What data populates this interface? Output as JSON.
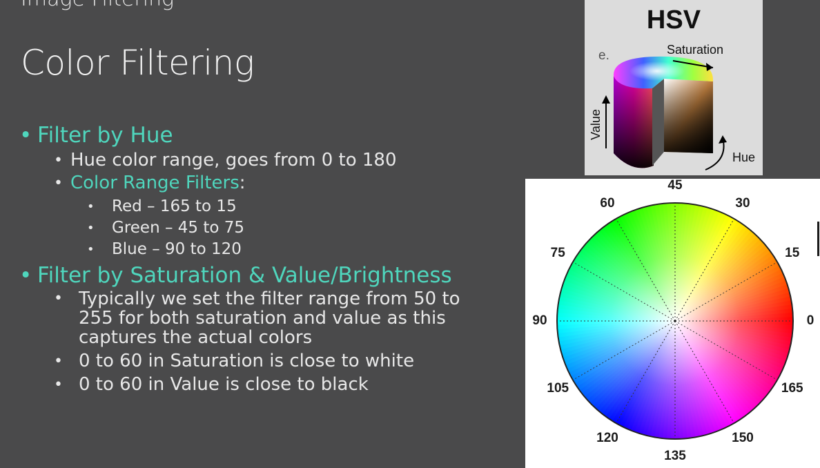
{
  "slide": {
    "partial_heading": "Image Filtering",
    "title": "Color Filtering",
    "sections": [
      {
        "heading": "Filter by Hue",
        "items": [
          {
            "text": "Hue color range, goes from 0 to 180"
          },
          {
            "text": "Color Range Filters",
            "suffix": ":",
            "subitems": [
              "Red – 165 to 15",
              "Green – 45 to 75",
              "Blue – 90 to 120"
            ]
          }
        ]
      },
      {
        "heading": "Filter by Saturation & Value/Brightness",
        "items": [
          {
            "text": "Typically we set the filter range from 50 to 255 for both saturation and value as this captures the actual colors"
          },
          {
            "text": "0 to 60 in Saturation is close to white"
          },
          {
            "text": "0 to 60 in Value is close to black"
          }
        ]
      }
    ]
  },
  "hsv_figure": {
    "title": "HSV",
    "panel_letter": "e.",
    "saturation_label": "Saturation",
    "value_label": "Value",
    "hue_label": "Hue"
  },
  "hue_wheel": {
    "degree_labels": [
      "0",
      "15",
      "30",
      "45",
      "60",
      "75",
      "90",
      "105",
      "120",
      "135",
      "150",
      "165"
    ]
  },
  "colors": {
    "background": "#4a4a4b",
    "accent": "#4fd6bd",
    "text": "#e8e8e8"
  }
}
